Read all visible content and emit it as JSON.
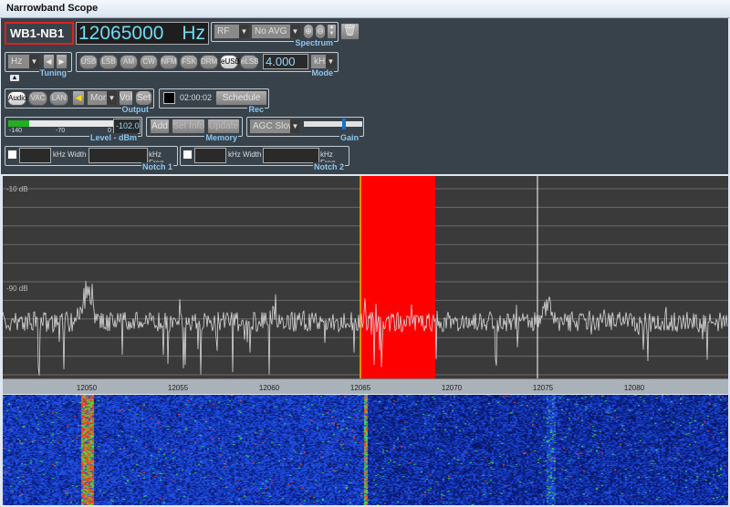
{
  "window": {
    "title": "Narrowband Scope"
  },
  "receiver": {
    "name": "WB1-NB1",
    "frequency": "12065000",
    "unit": "Hz"
  },
  "spectrum": {
    "label": "Spectrum",
    "source": "RF",
    "averaging": "No AVG"
  },
  "tuning": {
    "label": "Tuning",
    "step_unit": "Hz"
  },
  "mode": {
    "label": "Mode",
    "buttons": [
      "USB",
      "LSB",
      "AM",
      "CW",
      "NFM",
      "FSK",
      "DRM",
      "eUSB",
      "eLSB"
    ],
    "active": "eUSB",
    "bandwidth": "4.000",
    "bandwidth_unit": "kHz"
  },
  "output": {
    "label": "Output",
    "buttons": [
      "Audio",
      "VAC",
      "LAN"
    ],
    "channel": "Mono",
    "vol": "Vol",
    "set": "Set"
  },
  "rec": {
    "label": "Rec",
    "time": "02:00:02",
    "schedule": "Schedule"
  },
  "level": {
    "label": "Level - dBm",
    "value": "-102.0",
    "scale": [
      "-140",
      "-70",
      "0"
    ],
    "fill_fraction": 0.2
  },
  "memory": {
    "label": "Memory",
    "add": "Add",
    "set_info": "Set Info",
    "update": "Update"
  },
  "gain": {
    "label": "Gain",
    "agc": "AGC Slow",
    "slider_fraction": 0.65
  },
  "notch1": {
    "label": "Notch 1",
    "width_label": "kHz Width",
    "freq_label": "kHz Freq",
    "enabled": false
  },
  "notch2": {
    "label": "Notch 2",
    "width_label": "kHz Width",
    "freq_label": "kHz Freq",
    "enabled": false
  },
  "plot": {
    "db_labels": [
      "-10 dB",
      "-90 dB"
    ],
    "freq_ticks": [
      "12050",
      "12055",
      "12060",
      "12065",
      "12070",
      "12075",
      "12080"
    ],
    "passband_khz": [
      12065,
      12069
    ],
    "cursor_khz": 12074.7,
    "colors": {
      "passband": "#ff0000",
      "trace": "#d8d8d8",
      "cursor": "#ffffff",
      "tuned": "#ffb000"
    }
  }
}
